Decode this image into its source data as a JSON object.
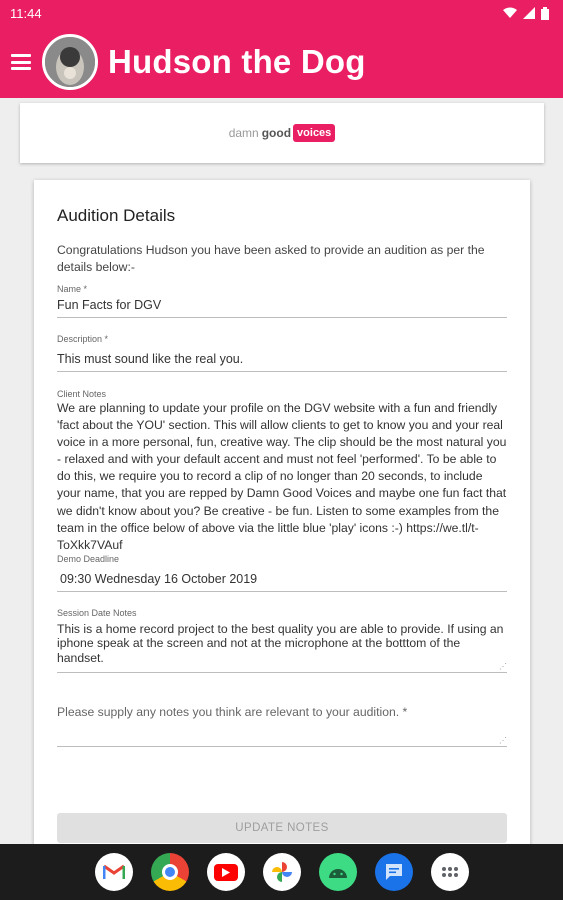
{
  "status": {
    "time": "11:44"
  },
  "appbar": {
    "title": "Hudson the Dog"
  },
  "logo": {
    "part1": "damn",
    "part2": "good",
    "part3": "voices"
  },
  "form": {
    "title": "Audition Details",
    "intro": "Congratulations Hudson you have been asked to provide an audition as per the details below:-",
    "name_label": "Name *",
    "name_value": "Fun Facts for DGV",
    "description_label": "Description *",
    "description_value": "This must sound like the real you.",
    "client_notes_label": "Client Notes",
    "client_notes_value": "We are planning to update your profile on the DGV website with a fun and friendly 'fact about the YOU' section. This will allow clients to get to know you and your real voice in a more personal, fun, creative way. The clip should be the most natural you - relaxed and with your default accent and must not feel 'performed'. To be able to do this, we require you to record a clip of no longer than 20 seconds, to include your name, that you are repped by Damn Good Voices and maybe one fun fact that we didn't know about you? Be creative - be fun. Listen to some examples from the team in the office below of above via the little blue 'play' icons :-) https://we.tl/t-ToXkk7VAuf",
    "deadline_label": "Demo Deadline",
    "deadline_value": "09:30 Wednesday 16 October 2019",
    "session_label": "Session Date Notes",
    "session_value": "This is a home record project to the best quality you are able to provide. If using an iphone speak at the screen and not at the microphone at the botttom of the handset.",
    "notes_placeholder": "Please supply any notes you think are relevant to your audition. *",
    "update_button": "UPDATE NOTES"
  },
  "navbar": {
    "apps": [
      "gmail-icon",
      "chrome-icon",
      "youtube-icon",
      "photos-icon",
      "android-icon",
      "messages-icon",
      "app-drawer-icon"
    ]
  },
  "colors": {
    "brand": "#e91e63",
    "navbar": "#1c1c1c"
  }
}
